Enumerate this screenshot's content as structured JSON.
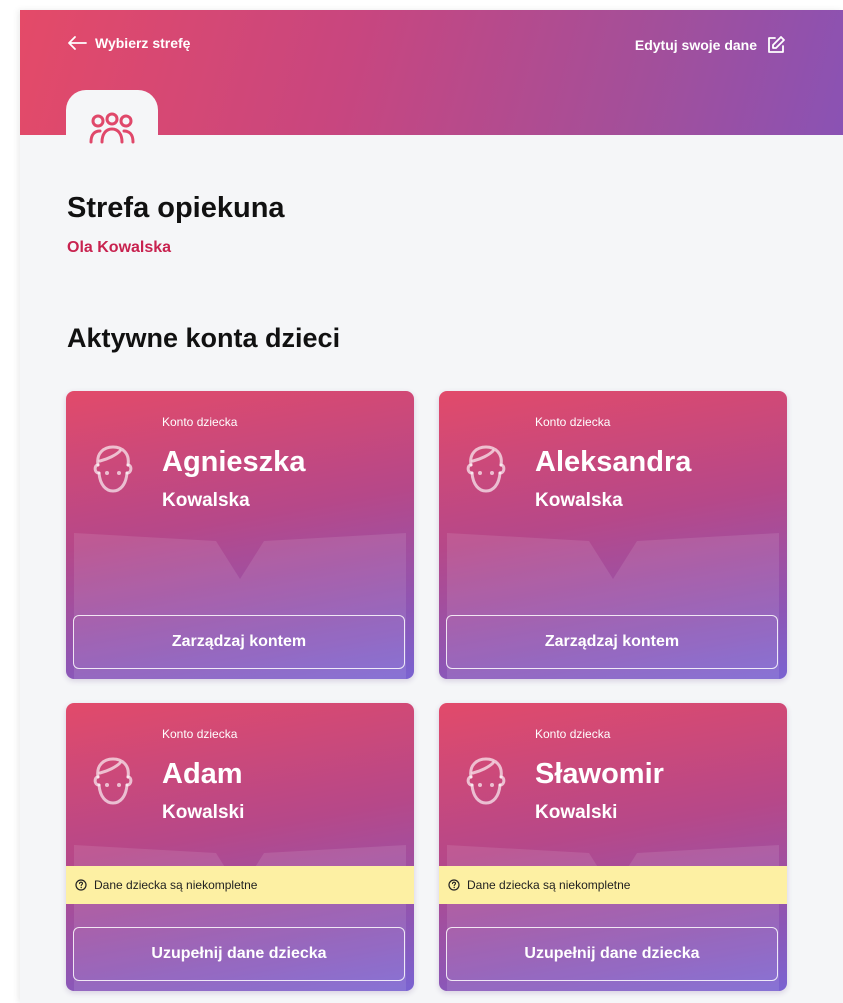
{
  "header": {
    "back_label": "Wybierz strefę",
    "edit_label": "Edytuj swoje dane"
  },
  "page": {
    "title": "Strefa opiekuna",
    "subtitle": "Ola Kowalska",
    "section_title": "Aktywne konta dzieci"
  },
  "cards": [
    {
      "label": "Konto dziecka",
      "first_name": "Agnieszka",
      "last_name": "Kowalska",
      "button": "Zarządzaj kontem",
      "warning": ""
    },
    {
      "label": "Konto dziecka",
      "first_name": "Aleksandra",
      "last_name": "Kowalska",
      "button": "Zarządzaj kontem",
      "warning": ""
    },
    {
      "label": "Konto dziecka",
      "first_name": "Adam",
      "last_name": "Kowalski",
      "button": "Uzupełnij dane dziecka",
      "warning": "Dane dziecka są niekompletne"
    },
    {
      "label": "Konto dziecka",
      "first_name": "Sławomir",
      "last_name": "Kowalski",
      "button": "Uzupełnij dane dziecka",
      "warning": "Dane dziecka są niekompletne"
    }
  ],
  "icons": {
    "back": "arrow-left-icon",
    "edit": "edit-icon",
    "zone": "group-icon",
    "child": "child-face-icon",
    "warning": "question-circle-icon"
  },
  "colors": {
    "header_start": "#e44a68",
    "header_end": "#8a52b4",
    "accent_text": "#c8224f",
    "warning_bg": "#fdf0a3"
  }
}
